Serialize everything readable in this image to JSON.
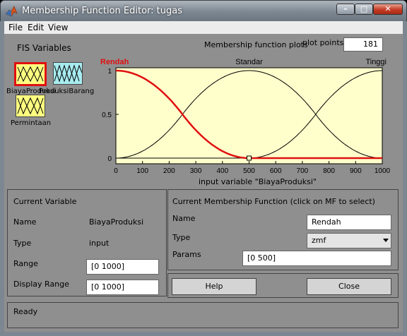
{
  "window": {
    "title": "Membership Function Editor: tugas",
    "minimize_glyph": "–",
    "maximize_glyph": "□",
    "close_glyph": "✕"
  },
  "menu": {
    "items": [
      "File",
      "Edit",
      "View"
    ]
  },
  "fis_variables": {
    "title": "FIS Variables",
    "variables": [
      {
        "name": "BiayaProduksi",
        "kind": "input",
        "selected": true
      },
      {
        "name": "ProduksiBarang",
        "kind": "output",
        "selected": false
      },
      {
        "name": "Permintaan",
        "kind": "input",
        "selected": false
      }
    ]
  },
  "plot": {
    "title": "Membership function plots",
    "plot_points_label": "plot points:",
    "plot_points_value": "181",
    "xlabel": "input variable \"BiayaProduksi\""
  },
  "chart_data": {
    "type": "line",
    "xlim": [
      0,
      1000
    ],
    "ylim": [
      0,
      1
    ],
    "x_ticks": [
      0,
      100,
      200,
      300,
      400,
      500,
      600,
      700,
      800,
      900,
      1000
    ],
    "y_ticks": [
      0,
      0.5,
      1
    ],
    "series": [
      {
        "name": "Rendah",
        "shape": "zmf",
        "params": [
          0,
          500
        ],
        "selected": true,
        "x": [
          0,
          50,
          100,
          150,
          200,
          250,
          300,
          350,
          400,
          450,
          500,
          550,
          600,
          650,
          700,
          750,
          800,
          850,
          900,
          950,
          1000
        ],
        "y": [
          1,
          0.98,
          0.92,
          0.82,
          0.68,
          0.5,
          0.32,
          0.18,
          0.08,
          0.02,
          0,
          0,
          0,
          0,
          0,
          0,
          0,
          0,
          0,
          0,
          0
        ]
      },
      {
        "name": "Standar",
        "shape": "gbell",
        "x": [
          0,
          50,
          100,
          150,
          200,
          250,
          300,
          350,
          400,
          450,
          500,
          550,
          600,
          650,
          700,
          750,
          800,
          850,
          900,
          950,
          1000
        ],
        "y": [
          0,
          0.02,
          0.08,
          0.18,
          0.32,
          0.5,
          0.68,
          0.82,
          0.92,
          0.98,
          1,
          0.98,
          0.92,
          0.82,
          0.68,
          0.5,
          0.32,
          0.18,
          0.08,
          0.02,
          0
        ]
      },
      {
        "name": "Tinggi",
        "shape": "smf",
        "x": [
          0,
          50,
          100,
          150,
          200,
          250,
          300,
          350,
          400,
          450,
          500,
          550,
          600,
          650,
          700,
          750,
          800,
          850,
          900,
          950,
          1000
        ],
        "y": [
          0,
          0,
          0,
          0,
          0,
          0,
          0,
          0,
          0,
          0,
          0,
          0.02,
          0.08,
          0.18,
          0.32,
          0.5,
          0.68,
          0.82,
          0.92,
          0.98,
          1
        ]
      }
    ],
    "colors": {
      "selected": "#e01010",
      "normal": "#000000",
      "background": "#ffffcc"
    }
  },
  "current_variable": {
    "title": "Current Variable",
    "name_label": "Name",
    "name_value": "BiayaProduksi",
    "type_label": "Type",
    "type_value": "input",
    "range_label": "Range",
    "range_value": "[0 1000]",
    "display_range_label": "Display Range",
    "display_range_value": "[0 1000]"
  },
  "current_mf": {
    "title": "Current Membership Function (click on MF to select)",
    "name_label": "Name",
    "name_value": "Rendah",
    "type_label": "Type",
    "type_value": "zmf",
    "params_label": "Params",
    "params_value": "[0 500]"
  },
  "buttons": {
    "help": "Help",
    "close": "Close"
  },
  "status": {
    "text": "Ready"
  },
  "icons": {
    "dropdown": "chevron-down-icon"
  }
}
